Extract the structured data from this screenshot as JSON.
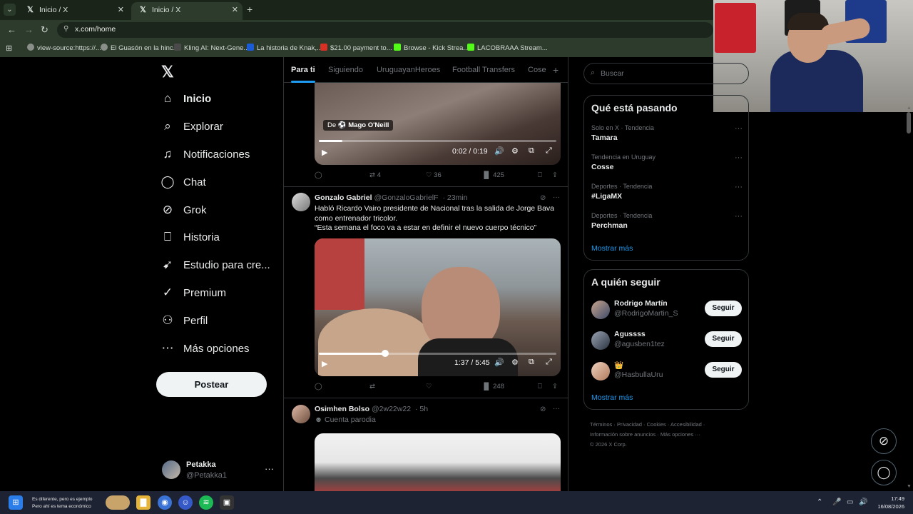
{
  "browser": {
    "tabs": [
      {
        "title": "Inicio / X"
      },
      {
        "title": "Inicio / X"
      }
    ],
    "url": "x.com/home",
    "bookmarks": [
      {
        "label": "view-source:https://..."
      },
      {
        "label": "El Guasón en la hinc..."
      },
      {
        "label": "Kling AI: Next-Gene..."
      },
      {
        "label": "La historia de Knak,..."
      },
      {
        "label": "$21.00 payment to..."
      },
      {
        "label": "Browse - Kick Strea..."
      },
      {
        "label": "LACOBRAAA Stream..."
      }
    ]
  },
  "nav": {
    "items": [
      {
        "label": "Inicio",
        "icon": "home-icon"
      },
      {
        "label": "Explorar",
        "icon": "search-icon"
      },
      {
        "label": "Notificaciones",
        "icon": "bell-icon"
      },
      {
        "label": "Chat",
        "icon": "chat-icon"
      },
      {
        "label": "Grok",
        "icon": "grok-icon"
      },
      {
        "label": "Historia",
        "icon": "bookmark-icon"
      },
      {
        "label": "Estudio para cre...",
        "icon": "rocket-icon"
      },
      {
        "label": "Premium",
        "icon": "verified-icon"
      },
      {
        "label": "Perfil",
        "icon": "person-icon"
      },
      {
        "label": "Más opciones",
        "icon": "more-circle-icon"
      }
    ],
    "post_label": "Postear",
    "user": {
      "name": "Petakka",
      "handle": "@Petakka1"
    }
  },
  "feed": {
    "tabs": [
      "Para ti",
      "Siguiendo",
      "UruguayanHeroes",
      "Football Transfers",
      "Cose"
    ],
    "tweet1": {
      "source_prefix": "De",
      "source_name": "Mago O'Neill",
      "time": "0:02 / 0:19",
      "replies": "",
      "retweets": "4",
      "likes": "36",
      "views": "425"
    },
    "tweet2": {
      "name": "Gonzalo Gabriel",
      "handle": "@GonzaloGabrielF",
      "ago": "· 23min",
      "text1": "Habló Ricardo Vairo presidente de Nacional tras la salida de Jorge Bava como entrenador tricolor.",
      "text2": "“Esta semana el foco va a estar en definir el nuevo cuerpo técnico”",
      "time": "1:37 / 5:45",
      "progress": 0.28,
      "views": "248"
    },
    "tweet3": {
      "name": "Osimhen Bolso",
      "handle": "@2w22w22",
      "ago": "· 5h",
      "badge": "Cuenta parodia"
    }
  },
  "right": {
    "search_placeholder": "Buscar",
    "trends_title": "Qué está pasando",
    "trends": [
      {
        "context": "Solo en X · Tendencia",
        "name": "Tamara"
      },
      {
        "context": "Tendencia en Uruguay",
        "name": "Cosse"
      },
      {
        "context": "Deportes · Tendencia",
        "name": "#LigaMX"
      },
      {
        "context": "Deportes · Tendencia",
        "name": "Perchman"
      }
    ],
    "trends_more": "Mostrar más",
    "wtf_title": "A quién seguir",
    "wtf": [
      {
        "name": "Rodrigo Martín",
        "handle": "@RodrigoMartin_S",
        "button": "Seguir"
      },
      {
        "name": "Agussss",
        "handle": "@agusben1tez",
        "button": "Seguir"
      },
      {
        "name": "👑",
        "handle": "@HasbullaUru",
        "button": "Seguir"
      }
    ],
    "wtf_more": "Mostrar más",
    "footer": [
      "Términos",
      "Privacidad",
      "Cookies",
      "Accesibilidad",
      "Información sobre anuncios",
      "Más opciones ···",
      "© 2026 X Corp."
    ]
  },
  "taskbar": {
    "news_line1": "Es diferente, pero es ejemplo",
    "news_line2": "Pero ahí es tema económico",
    "time": "17:49",
    "date": "16/08/2026"
  },
  "colors": {
    "accent": "#1d9bf0",
    "browser_bar": "#2c3b2c",
    "background": "#000000"
  }
}
